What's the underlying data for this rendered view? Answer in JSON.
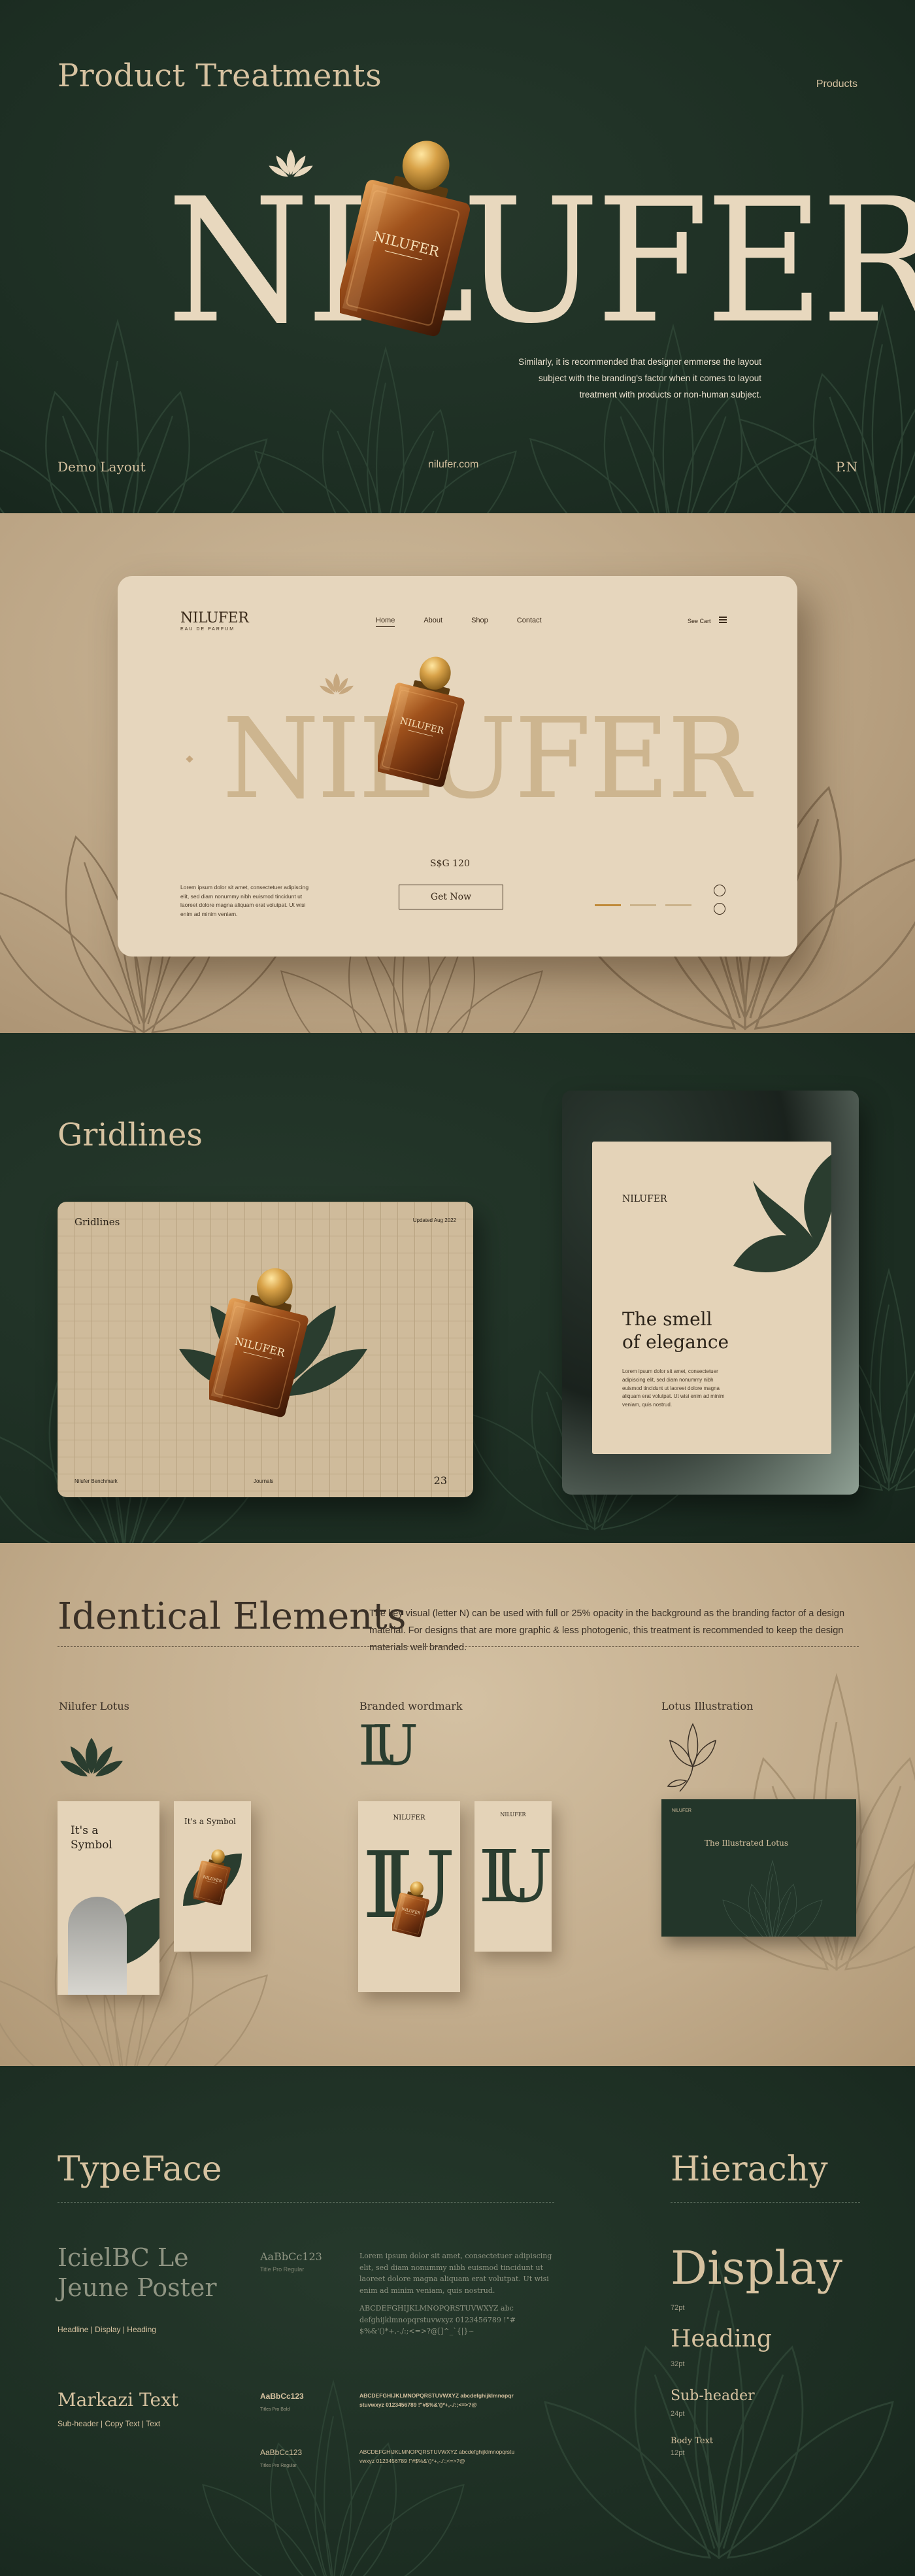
{
  "hero": {
    "title": "Product Treatments",
    "tag": "Products",
    "brand": "NILUFER",
    "description": "Similarly, it is recommended that designer emmerse the layout subject with the branding's factor when it comes to layout treatment with products or non-human subject.",
    "footer_left": "Demo Layout",
    "footer_center": "nilufer.com",
    "footer_right": "P.N",
    "bottle_label": "NILUFER"
  },
  "mockup": {
    "logo": "NILUFER",
    "logo_sub": "EAU DE PARFUM",
    "nav": [
      "Home",
      "About",
      "Shop",
      "Contact"
    ],
    "cart": "See Cart",
    "brand": "NILUFER",
    "price": "S$G 120",
    "cta": "Get Now",
    "blurb": "Lorem ipsum dolor sit amet, consectetuer adipiscing elit, sed diam nonummy nibh euismod tincidunt ut laoreet dolore magna aliquam erat volutpat. Ut wisi enim ad minim veniam.",
    "bottle_label": "NILUFER"
  },
  "gridlines": {
    "title": "Gridlines",
    "card_title": "Gridlines",
    "card_date": "Updated Aug 2022",
    "card_foot_left": "Nilufer Benchmark",
    "card_foot_center": "Journals",
    "card_page": "23",
    "poster_logo": "NILUFER",
    "poster_heading_1": "The smell",
    "poster_heading_2": "of elegance",
    "poster_body": "Lorem ipsum dolor sit amet, consectetuer adipiscing elit, sed diam nonummy nibh euismod tincidunt ut laoreet dolore magna aliquam erat volutpat. Ut wisi enim ad minim veniam, quis nostrud.",
    "bottle_label": "NILUFER"
  },
  "identical": {
    "title": "Identical Elements",
    "description": "The key visual (letter N) can be used with full or 25% opacity in the background as the branding factor of a design material. For designs that are more graphic & less photogenic, this treatment is recommended to keep the design materials well branded.",
    "label_lotus": "Nilufer Lotus",
    "label_wordmark": "Branded wordmark",
    "label_illustration": "Lotus Illustration",
    "story_1": "It's a Symbol",
    "story_2": "It's a Symbol",
    "monogram": "LU",
    "monogram_label": "NILUFER",
    "screen_logo": "NILUFER",
    "screen_title": "The Illustrated Lotus",
    "bottle_label": "NILUFER"
  },
  "typeface": {
    "title": "TypeFace",
    "font1_name": "IcielBC Le Jeune Poster",
    "font1_uses": "Headline | Display | Heading",
    "font1_sample": "AaBbCc123",
    "font1_caption": "Title Pro Regular",
    "font1_para": "Lorem ipsum dolor sit amet, consectetuer adipiscing elit, sed diam nonummy nibh euismod tincidunt ut laoreet dolore magna aliquam erat volutpat. Ut wisi enim ad minim veniam, quis nostrud.",
    "font1_glyphs": "ABCDEFGHIJKLMNOPQRSTUVWXYZ abcdefghijklmnopqrstuvwxyz 0123456789 !\"#$%&'()*+,-./:;<=>?@[]^_`{|}~",
    "font2_name": "Markazi Text",
    "font2_uses": "Sub-header | Copy Text | Text",
    "font2_sample_a": "AaBbCc123",
    "font2_caption_a": "Titles Pro Bold",
    "font2_sample_b": "AaBbCc123",
    "font2_caption_b": "Titles Pro Regular",
    "font2_glyphs_a": "ABCDEFGHIJKLMNOPQRSTUVWXYZ abcdefghijklmnopqrstuvwxyz 0123456789 !\"#$%&'()*+,-./:;<=>?@",
    "font2_glyphs_b": "ABCDEFGHIJKLMNOPQRSTUVWXYZ abcdefghijklmnopqrstuvwxyz 0123456789 !\"#$%&'()*+,-./:;<=>?@"
  },
  "hierarchy": {
    "title": "Hierachy",
    "display": "Display",
    "display_size": "72pt",
    "heading": "Heading",
    "heading_size": "32pt",
    "subheader": "Sub-header",
    "subheader_size": "24pt",
    "body": "Body Text",
    "body_size": "12pt"
  },
  "colors": {
    "dark_green": "#1e3226",
    "cream": "#e7d6bc",
    "tan": "#c2ac8c",
    "amber": "#b06a2a"
  }
}
